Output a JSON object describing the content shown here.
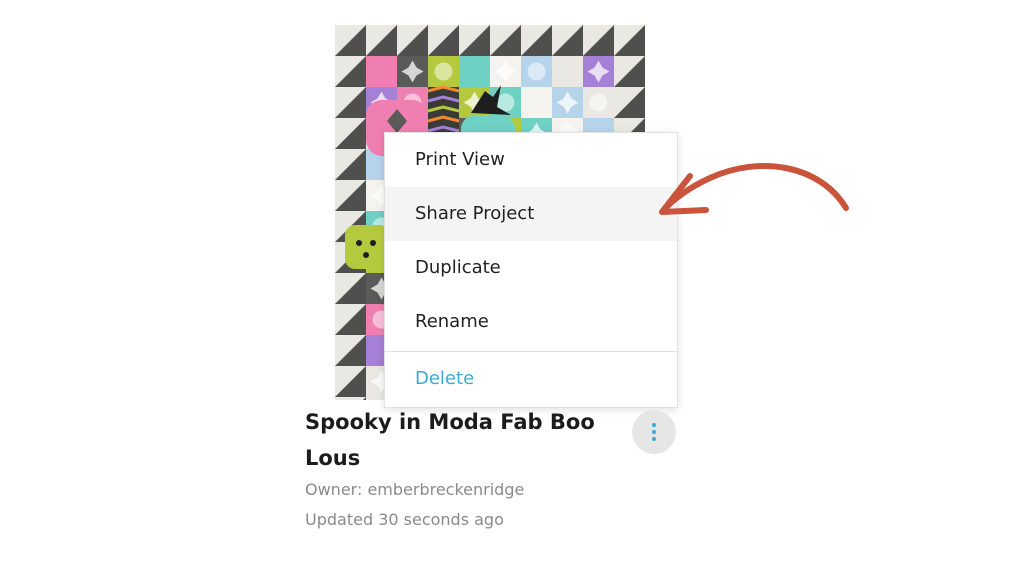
{
  "project": {
    "title": "Spooky in Moda Fab Boo Lous",
    "owner": "Owner: emberbreckenridge",
    "updated": "Updated 30 seconds ago"
  },
  "menu": {
    "items": [
      {
        "label": "Print View"
      },
      {
        "label": "Share Project",
        "highlighted": true
      },
      {
        "label": "Duplicate"
      },
      {
        "label": "Rename"
      }
    ],
    "delete_label": "Delete"
  },
  "icons": {
    "more": "more-vertical-icon",
    "annotation": "curved-arrow"
  },
  "colors": {
    "accent": "#3fa9d2",
    "arrow": "#c9533b",
    "menu_hover": "#f4f4f4"
  }
}
